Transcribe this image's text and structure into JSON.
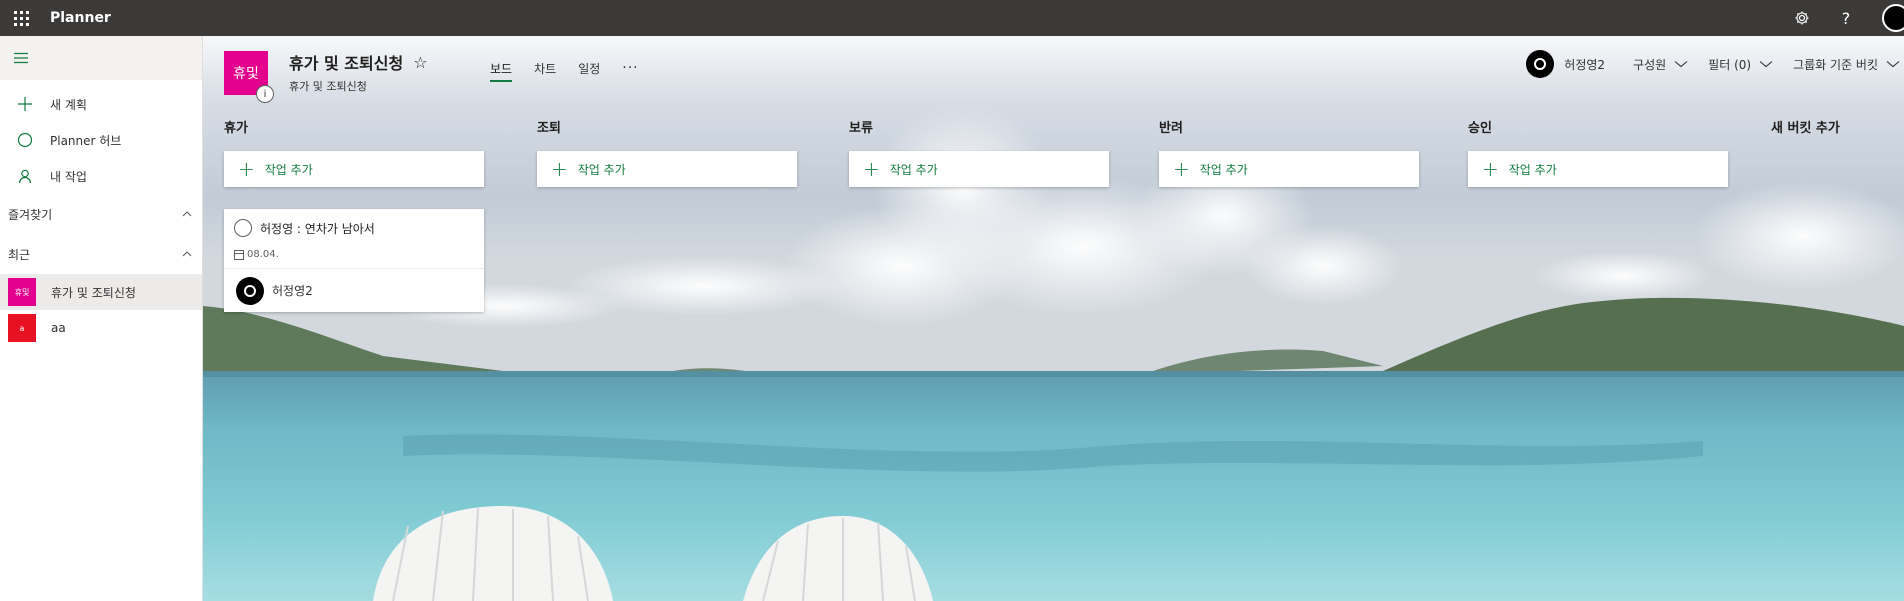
{
  "app": {
    "name": "Planner"
  },
  "topbar": {
    "settings_icon": "gear-icon",
    "help_icon": "question-icon",
    "help_glyph": "?"
  },
  "sidebar": {
    "nav": [
      {
        "label": "새 계획",
        "icon": "plus-icon"
      },
      {
        "label": "Planner 허브",
        "icon": "circle-icon"
      },
      {
        "label": "내 작업",
        "icon": "person-icon"
      }
    ],
    "favorites_label": "즐겨찾기",
    "recent_label": "최근",
    "recent_plans": [
      {
        "tile": "휴및",
        "label": "휴가 및 조퇴신청",
        "color": "#e3008c"
      },
      {
        "tile": "a",
        "label": "aa",
        "color": "#e81123"
      }
    ]
  },
  "plan": {
    "logo": "휴및",
    "info": "i",
    "title": "휴가 및 조퇴신청",
    "star": "☆",
    "subtitle": "휴가 및 조퇴신청",
    "tabs": [
      "보드",
      "차트",
      "일정"
    ],
    "more": "···"
  },
  "header_right": {
    "owner": "허정영2",
    "members": "구성원",
    "filter": "필터 (0)",
    "group_by": "그룹화 기준 버킷"
  },
  "buckets": [
    {
      "name": "휴가",
      "add_label": "작업 추가"
    },
    {
      "name": "조퇴",
      "add_label": "작업 추가"
    },
    {
      "name": "보류",
      "add_label": "작업 추가"
    },
    {
      "name": "반려",
      "add_label": "작업 추가"
    },
    {
      "name": "승인",
      "add_label": "작업 추가"
    }
  ],
  "new_bucket": "새 버킷 추가",
  "task": {
    "title": "허정영 : 연차가 남아서",
    "date": "08.04.",
    "assignee": "허정영2"
  },
  "colors": {
    "accent": "#107c41",
    "topbar": "#3b3a39",
    "plan_tile": "#e3008c"
  }
}
